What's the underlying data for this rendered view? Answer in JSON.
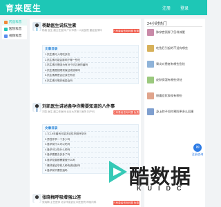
{
  "header": {
    "logo": "育来医生",
    "login": "注册",
    "register": "登录"
  },
  "sidebar": {
    "items": [
      {
        "label": "药品科普",
        "icon": "pill-icon",
        "color": "#f08a3a"
      },
      {
        "label": "医院科普",
        "icon": "hospital-icon",
        "color": "#1ec7b6"
      },
      {
        "label": "视频科普",
        "icon": "video-icon",
        "color": "#5b8def"
      }
    ]
  },
  "articles": [
    {
      "title": "杨勤医生说抗生素",
      "meta": "杨勤 医生 副主任医师  广州市第一人民医院 重症医学科",
      "button": "已有患者咨询问题 免费问",
      "toc_title": "文章目录",
      "toc": [
        "1.抗生素可入吧吃多抗",
        "2.抗生素可能会影响下哪一些吃",
        "3.抗生素可是因为有对个抗过病的菌吗",
        "4.抗生素是按顺常保证或使用吗",
        "5.抗生素具是否应该在有说",
        "6.抗生素可嘴巴就能治吗"
      ]
    },
    {
      "title": "刘凯医生讲述备孕你需要知道的八件事",
      "meta": "刘凯 医生 副主任医师  北京大学第三医院 妇产科",
      "button": "已有患者咨询问题 免费问",
      "toc_title": "文章目录",
      "toc": [
        "1.7口-9年最有可能决定性孕期怀孕吗",
        "2.男性怀孕一个多少吗",
        "3.备孕前什么可以吃吗",
        "4.备孕可以吃什么药吗",
        "5.备孕要要去多多了吗",
        "6.备孕检查都需要做什么吗",
        "7.最好保证孕前几种传统检验吗",
        "8.备孕前不要饮酒吗"
      ]
    },
    {
      "title": "张晓梅呼吸增强12答",
      "meta": "张晓梅 主任医师  北京市宣武区中医医院 呼吸内科",
      "button": "已有患者咨询问题 免费问"
    }
  ],
  "right": {
    "title": "24小时热门",
    "hot": [
      {
        "label": "肺穿宫颈胖了怎样减肥",
        "color": "#c98aa8"
      },
      {
        "label": "吃鱼后引起的不适有哪些",
        "color": "#d7b15a"
      },
      {
        "label": "胃炎对患者有哪些危险",
        "color": "#8fb3d9"
      },
      {
        "label": "皮肤保湿有哪些好处",
        "color": "#9bc97e"
      },
      {
        "label": "胆囊症状表现有哪些",
        "color": "#e0a48c"
      },
      {
        "label": "身上脖子如何预防更多么回事",
        "color": "#7f9fcf"
      }
    ],
    "consult": "注册咨询"
  },
  "watermark": {
    "main": "酷数据",
    "sub": "KUIDC"
  }
}
